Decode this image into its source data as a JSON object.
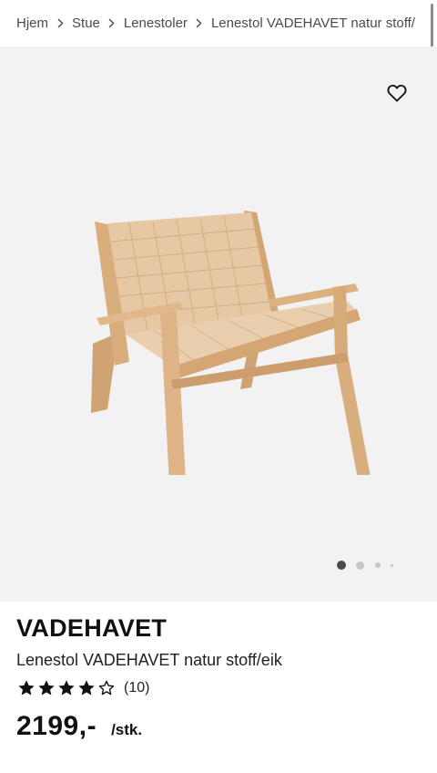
{
  "breadcrumb": {
    "items": [
      "Hjem",
      "Stue",
      "Lenestoler",
      "Lenestol VADEHAVET natur stoff/"
    ]
  },
  "gallery": {
    "image_alt": "Lenestol VADEHAVET natur stoff/eik",
    "favorite_icon": "heart-outline-icon",
    "dots_total": 4,
    "active_dot": 1
  },
  "product": {
    "name": "VADEHAVET",
    "description": "Lenestol VADEHAVET natur stoff/eik",
    "rating": 4,
    "rating_max": 5,
    "review_count": "(10)",
    "price": "2199,-",
    "unit": "/stk."
  },
  "colors": {
    "gallery_bg": "#f2f2f2",
    "text": "#111111",
    "muted": "#4a4a4a",
    "dot_active": "#4a4a4a",
    "dot_inactive": "#c6c6c6"
  }
}
